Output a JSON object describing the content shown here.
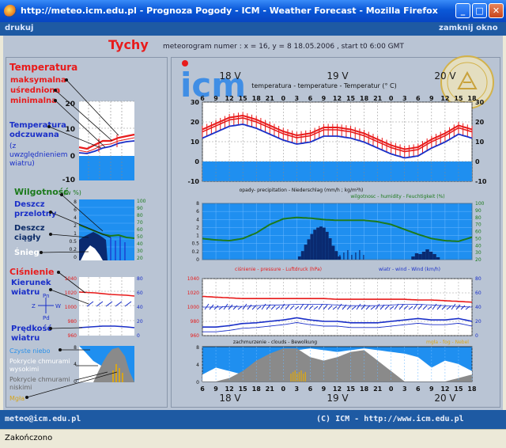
{
  "window": {
    "title": "http://meteo.icm.edu.pl - Prognoza Pogody - ICM - Weather Forecast - Mozilla Firefox",
    "minimize": "_",
    "maximize": "□",
    "close": "✕"
  },
  "menu": {
    "print": "drukuj",
    "close_window": "zamknij okno"
  },
  "header": {
    "city": "Tychy",
    "info": "meteorogram numer : x = 16, y = 8        18.05.2006 , start t0 6:00 GMT"
  },
  "legend": {
    "temperature_title": "Temperatura",
    "temperature_lines": [
      "maksymalna",
      "uśredniona",
      "minimalna"
    ],
    "perceived_title": "Temperatura odczuwana",
    "perceived_note": "(z uwzględnieniem wiatru)",
    "humidity": "Wilgotność",
    "humidity_unit": "(w %)",
    "rain_conv": "Deszcz przelotny",
    "rain_cont": "Deszcz ciągły",
    "snow": "Śnieg",
    "pressure": "Ciśnienie",
    "wind_dir": "Kierunek wiatru",
    "wind_speed": "Prędkość wiatru",
    "compass": {
      "n": "Pn",
      "s": "Pd",
      "w": "Z",
      "e": "W"
    },
    "clear_sky": "Czyste niebo",
    "high_clouds": "Pokrycie chmurami wysokimi",
    "low_clouds": "Pokrycie chmurami niskimi",
    "fog": "Mgła",
    "temp_ticks": [
      "20",
      "10",
      "0",
      "-10"
    ],
    "hum_left_ticks": [
      "8",
      "6",
      "4",
      "2",
      "1",
      "0.5",
      "0.2",
      "0"
    ],
    "hum_right_ticks": [
      "100",
      "90",
      "80",
      "70",
      "60",
      "50",
      "40",
      "30",
      "20"
    ],
    "pres_ticks": [
      "1040",
      "1020",
      "1000",
      "980",
      "960"
    ],
    "wind_ticks": [
      "80",
      "60",
      "40",
      "20",
      "0"
    ],
    "cloud_ticks": [
      "8",
      "4",
      "0"
    ]
  },
  "meteogram": {
    "logo": "icm",
    "day_labels": [
      "18 V",
      "19 V",
      "20 V"
    ],
    "hours": [
      "6",
      "9",
      "12",
      "15",
      "18",
      "21",
      "0",
      "3",
      "6",
      "9",
      "12",
      "15",
      "18",
      "21",
      "0",
      "3",
      "6",
      "9",
      "12",
      "15",
      "18"
    ],
    "temperature_title": "temperatura - temperature - Temperatur (° C)",
    "temp_ticks": [
      "30",
      "20",
      "10",
      "0",
      "-10"
    ],
    "precip_title": "opady- precipitation - Niederschlag (mm/h ; kg/m²h)",
    "humidity_title": "wilgotnosc - humidity - Feuchtigkeit (%)",
    "precip_ticks": [
      "8",
      "6",
      "4",
      "2",
      "1",
      "0.5",
      "0.2",
      "0"
    ],
    "hum_ticks": [
      "100",
      "90",
      "80",
      "70",
      "60",
      "50",
      "40",
      "30",
      "20"
    ],
    "pressure_title": "ciśnienie - pressure - Luftdruck (hPa)",
    "wind_title": "wiatr - wind - Wind (km/h)",
    "pres_ticks": [
      "1040",
      "1020",
      "1000",
      "980",
      "960"
    ],
    "wind_ticks": [
      "80",
      "60",
      "40",
      "20",
      "0"
    ],
    "clouds_title": "zachmurzenie - clouds - Bewolkung",
    "fog_title": "mgła - fog - Nebel",
    "cloud_ticks": [
      "8",
      "4",
      "0"
    ]
  },
  "footer": {
    "email": "meteo@icm.edu.pl",
    "copyright": "(C) ICM - http://www.icm.edu.pl"
  },
  "status": {
    "text": "Zakończono"
  },
  "chart_data": {
    "type": "line",
    "x": [
      "6",
      "9",
      "12",
      "15",
      "18",
      "21",
      "0",
      "3",
      "6",
      "9",
      "12",
      "15",
      "18",
      "21",
      "0",
      "3",
      "6",
      "9",
      "12",
      "15",
      "18"
    ],
    "series": [
      {
        "name": "temperatura",
        "values": [
          15,
          18,
          21,
          22,
          20,
          17,
          14,
          12,
          13,
          16,
          16,
          15,
          13,
          10,
          7,
          5,
          6,
          10,
          13,
          17,
          15
        ]
      },
      {
        "name": "wilgotnosc",
        "values": [
          50,
          48,
          47,
          50,
          58,
          70,
          78,
          80,
          79,
          77,
          76,
          76,
          76,
          74,
          70,
          63,
          56,
          50,
          47,
          46,
          52
        ]
      },
      {
        "name": "ciśnienie",
        "values": [
          1015,
          1014,
          1013,
          1012,
          1012,
          1012,
          1012,
          1012,
          1012,
          1012,
          1011,
          1011,
          1011,
          1011,
          1011,
          1011,
          1010,
          1010,
          1009,
          1008,
          1007
        ]
      },
      {
        "name": "wiatr",
        "values": [
          12,
          12,
          14,
          17,
          18,
          20,
          22,
          25,
          22,
          20,
          20,
          18,
          18,
          18,
          20,
          22,
          24,
          22,
          22,
          24,
          20
        ]
      }
    ]
  }
}
